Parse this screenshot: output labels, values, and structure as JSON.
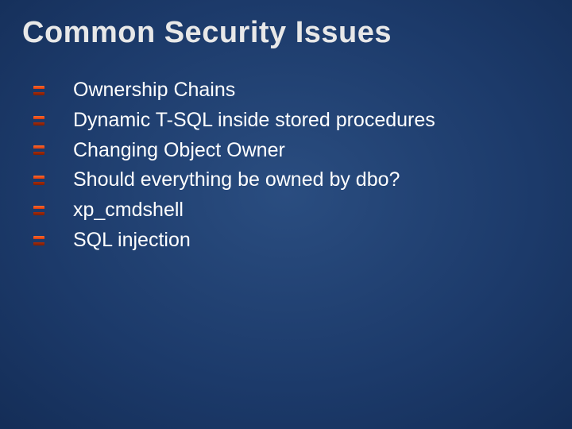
{
  "slide": {
    "title": "Common Security Issues",
    "bullets": [
      "Ownership Chains",
      "Dynamic T-SQL inside stored procedures",
      "Changing Object Owner",
      "Should everything be owned by dbo?",
      "xp_cmdshell",
      "SQL injection"
    ]
  }
}
